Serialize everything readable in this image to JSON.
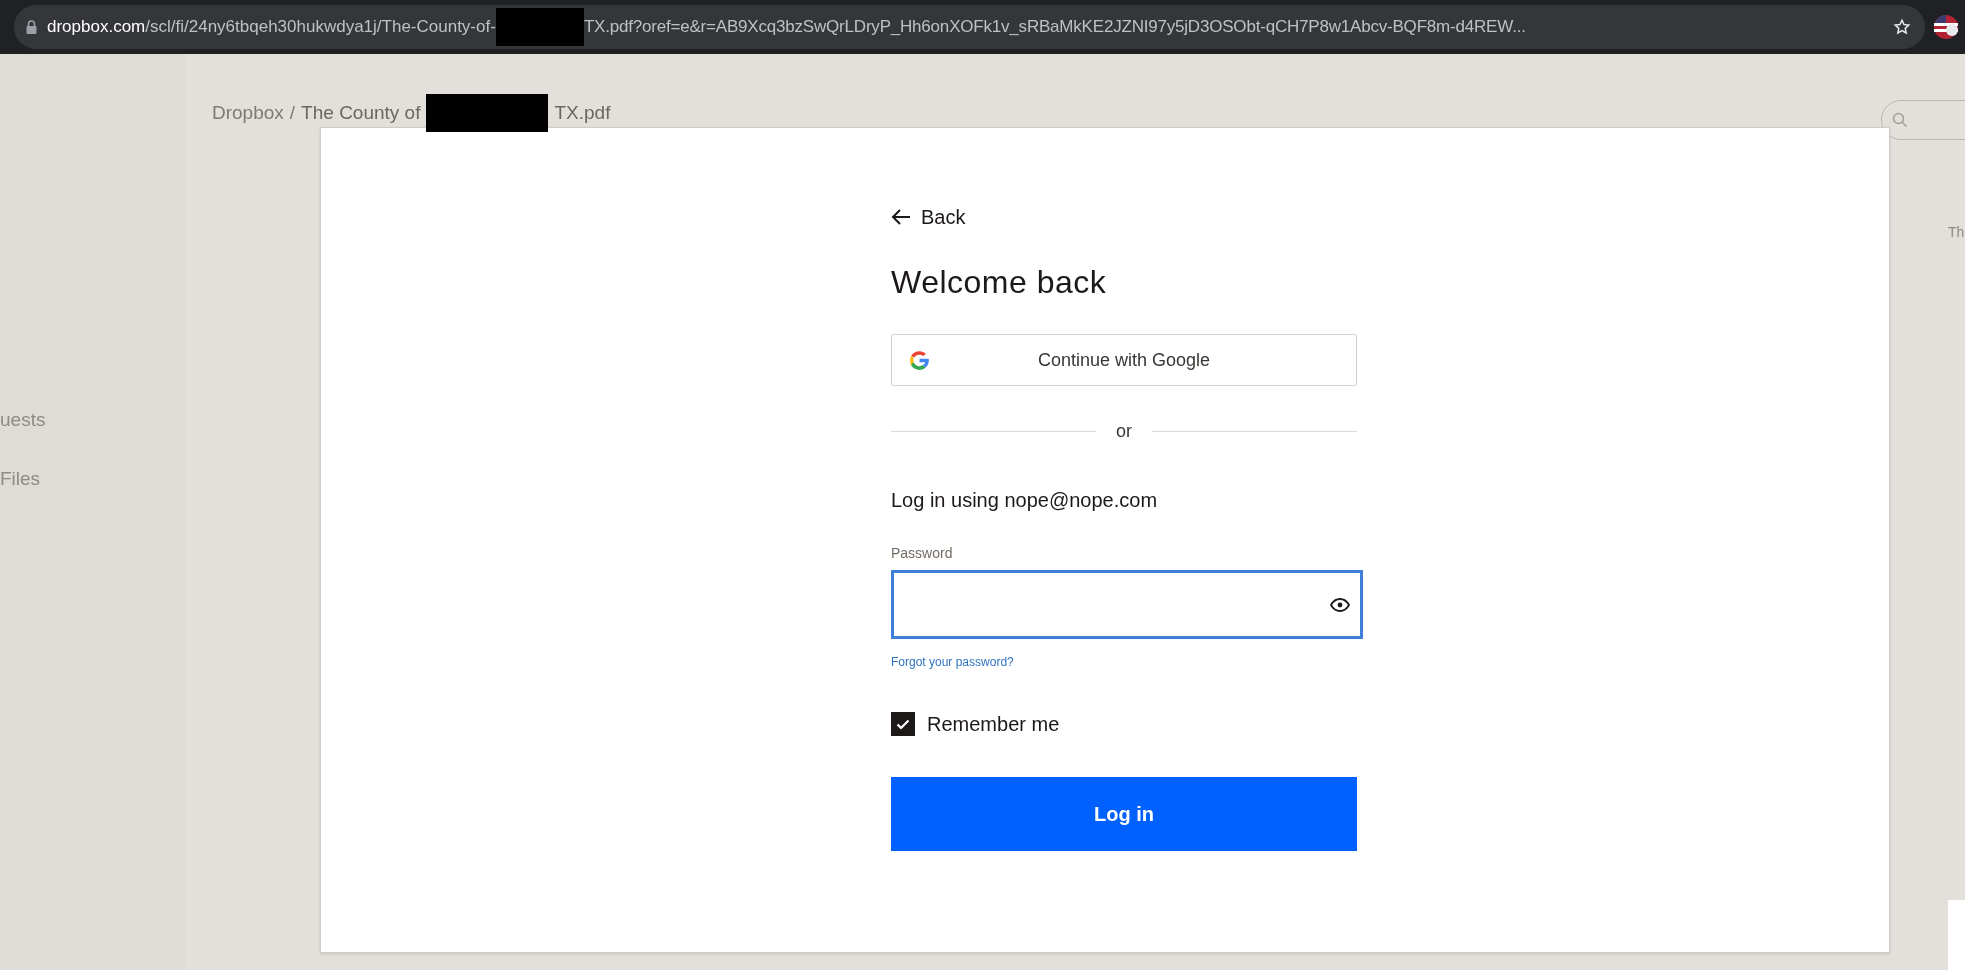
{
  "browser": {
    "url_domain": "dropbox.com",
    "url_path_before": "/scl/fi/24ny6tbqeh30hukwdya1j/The-County-of-",
    "url_path_after": "TX.pdf?oref=e&r=AB9Xcq3bzSwQrLDryP_Hh6onXOFk1v_sRBaMkKE2JZNI97y5jD3OSObt-qCH7P8w1Abcv-BQF8m-d4REW..."
  },
  "sidebar": {
    "items": [
      "uests",
      "Files"
    ]
  },
  "breadcrumb": {
    "root": "Dropbox",
    "separator": "/",
    "file_before": "The County of",
    "file_after": "TX.pdf"
  },
  "right_panel": {
    "text": "Th"
  },
  "login": {
    "back": "Back",
    "title": "Welcome back",
    "google_button": "Continue with Google",
    "divider": "or",
    "account_line": "Log in using nope@nope.com",
    "password_label": "Password",
    "forgot_link": "Forgot your password?",
    "remember": {
      "label": "Remember me",
      "checked": true
    },
    "submit": "Log in"
  }
}
